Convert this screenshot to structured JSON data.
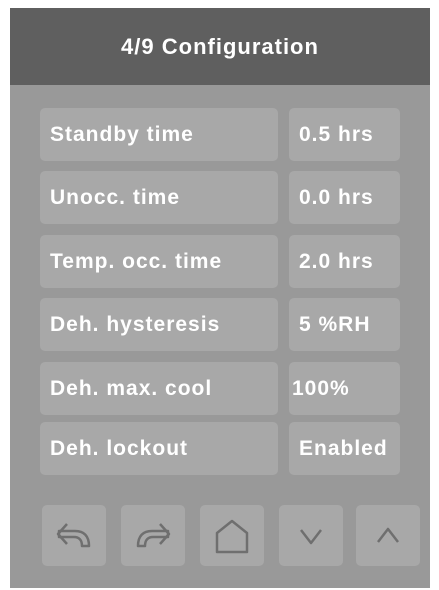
{
  "header": {
    "title": "4/9 Configuration"
  },
  "rows": [
    {
      "label": "Standby time",
      "value": "0.5 hrs"
    },
    {
      "label": "Unocc. time",
      "value": "0.0 hrs"
    },
    {
      "label": "Temp. occ. time",
      "value": "2.0 hrs"
    },
    {
      "label": "Deh. hysteresis",
      "value": "5 %RH"
    },
    {
      "label": "Deh. max. cool",
      "value": "100%"
    },
    {
      "label": "Deh. lockout",
      "value": "Enabled"
    }
  ],
  "footer": {
    "buttons": [
      {
        "icon": "undo-arrow-icon"
      },
      {
        "icon": "redo-arrow-icon"
      },
      {
        "icon": "home-icon"
      },
      {
        "icon": "chevron-down-icon"
      },
      {
        "icon": "chevron-up-icon"
      }
    ]
  },
  "colors": {
    "header_bg": "#5f5f5f",
    "panel_bg": "#999999",
    "cell_bg": "#a8a8a8",
    "icon": "#6f6f6f",
    "text": "#ffffff"
  }
}
